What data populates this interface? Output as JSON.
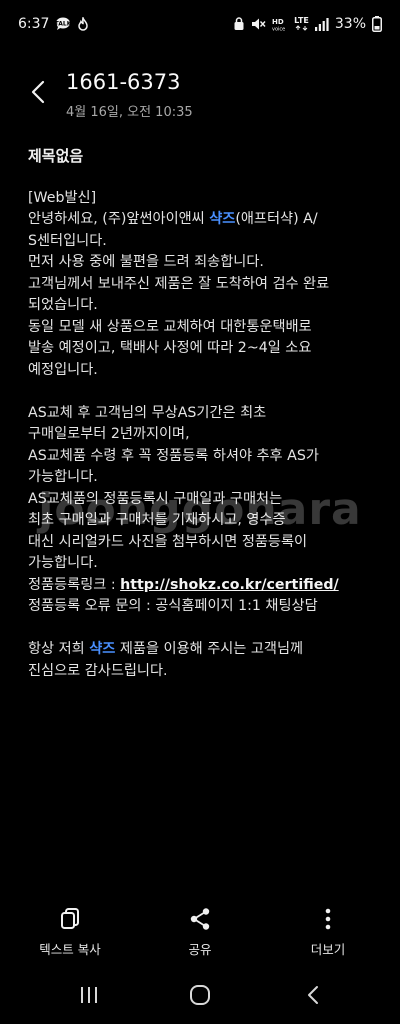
{
  "status_bar": {
    "time": "6:37",
    "lte_label": "LTE",
    "battery": "33%"
  },
  "header": {
    "title": "1661-6373",
    "date": "4월 16일, 오전 10:35"
  },
  "message": {
    "subject": "제목없음",
    "brand": "샥즈",
    "link_url": "http://shokz.co.kr/certified/",
    "lines": {
      "l1": "[Web발신]",
      "l2_pre": "안녕하세요, (주)앞썬아이앤씨 ",
      "l2_post": "(애프터샥) A/",
      "l3": "S센터입니다.",
      "l4": "먼저 사용 중에 불편을 드려 죄송합니다.",
      "l5": "고객님께서 보내주신 제품은 잘 도착하여 검수 완료",
      "l6": "되었습니다.",
      "l7": "동일 모델 새 상품으로 교체하여 대한통운택배로",
      "l8": "발송 예정이고, 택배사 사정에 따라 2~4일 소요",
      "l9": "예정입니다.",
      "l10": "AS교체 후 고객님의 무상AS기간은 최초",
      "l11": "구매일로부터 2년까지이며,",
      "l12": "AS교체품 수령 후 꼭 정품등록 하셔야 추후 AS가",
      "l13": "가능합니다.",
      "l14": "AS교체품의 정품등록시 구매일과 구매처는",
      "l15": "최초 구매일과 구매처를 기재하시고, 영수증",
      "l16": "대신 시리얼카드 사진을 첨부하시면 정품등록이",
      "l17": "가능합니다.",
      "l18_pre": "정품등록링크 : ",
      "l19": "정품등록 오류 문의 : 공식홈페이지 1:1 채팅상담",
      "l20_pre": "항상 저희 ",
      "l20_post": " 제품을 이용해 주시는 고객님께",
      "l21": "진심으로 감사드립니다."
    }
  },
  "watermark": "joonggonara",
  "toolbar": {
    "copy_label": "텍스트 복사",
    "share_label": "공유",
    "more_label": "더보기"
  },
  "icons": {
    "back": "chevron-left-icon",
    "copy": "copy-icon",
    "share": "share-icon",
    "more": "more-vertical-icon",
    "recents": "recents-icon",
    "home": "home-icon",
    "nav_back": "nav-back-icon"
  },
  "colors": {
    "background": "#000000",
    "highlight": "#4a90ff",
    "text": "#e4e4e4",
    "secondary_text": "#a8a8a8"
  }
}
